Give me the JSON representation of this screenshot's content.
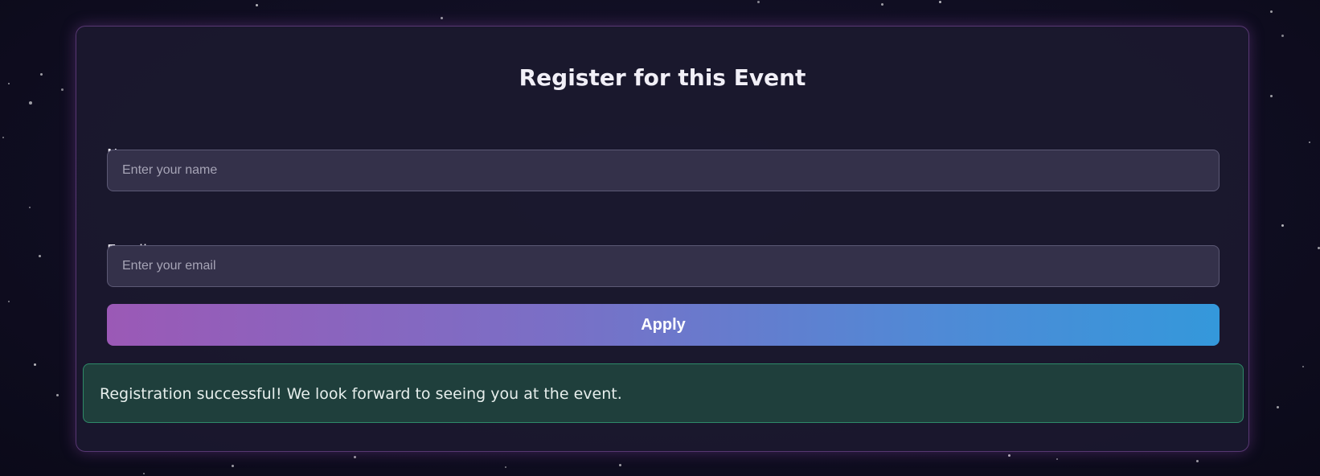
{
  "form": {
    "title": "Register for this Event",
    "name_label": "Name",
    "name_placeholder": "Enter your name",
    "name_value": "",
    "email_label": "Email",
    "email_placeholder": "Enter your email",
    "email_value": "",
    "apply_label": "Apply"
  },
  "status": {
    "message": "Registration successful! We look forward to seeing you at the event."
  },
  "colors": {
    "background": "#0f0d1f",
    "card_border": "#a55fc8",
    "button_gradient_start": "#9b59b6",
    "button_gradient_end": "#3498db",
    "success_background": "#1f3f3c",
    "success_border": "#2e8a68"
  }
}
